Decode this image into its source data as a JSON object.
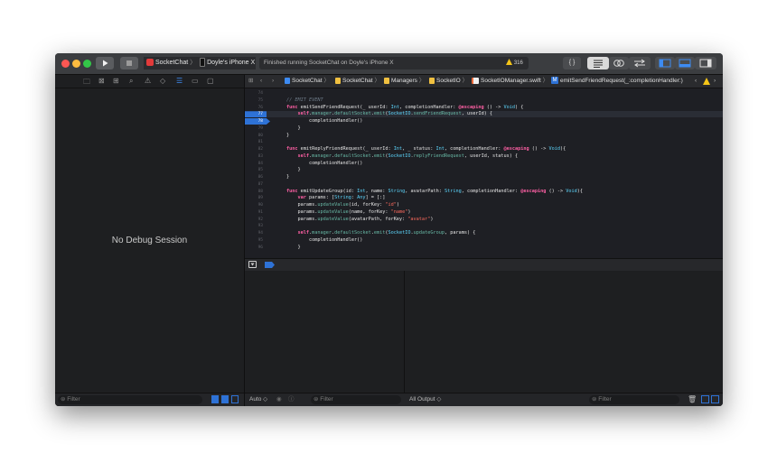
{
  "toolbar": {
    "scheme_name": "SocketChat",
    "scheme_sep": "〉",
    "device_name": "Doyle's iPhone X",
    "status_text": "Finished running SocketChat on Doyle's iPhone X",
    "warning_count": "316",
    "braces_label": "{ }"
  },
  "navigator": {
    "empty_text": "No Debug Session",
    "filter_placeholder": "Filter"
  },
  "jumpbar": {
    "crumbs": [
      "SocketChat",
      "SocketChat",
      "Managers",
      "SocketIO",
      "SocketIOManager.swift",
      "emitSendFriendRequest(_:completionHandler:)"
    ],
    "method_badge": "M"
  },
  "code": {
    "lines": [
      {
        "n": "74",
        "html": ""
      },
      {
        "n": "75",
        "html": "<span class='cm'>// EMIT EVENT</span>"
      },
      {
        "n": "76",
        "html": "<span class='kw'>func</span> emitSendFriendRequest(_ userId: <span class='ty'>Int</span>, completionHandler: <span class='kw'>@escaping</span> () -> <span class='ty'>Void</span>) {"
      },
      {
        "n": "77",
        "html": "    <span class='kw'>self</span>.<span class='fn'>manager</span>.<span class='fn'>defaultSocket</span>.<span class='fn'>emit</span>(<span class='ty'>SocketIO</span>.<span class='fn'>sendFriendRequest</span>, userId) {"
      },
      {
        "n": "78",
        "html": "        completionHandler()"
      },
      {
        "n": "79",
        "html": "    }"
      },
      {
        "n": "80",
        "html": "}"
      },
      {
        "n": "81",
        "html": ""
      },
      {
        "n": "82",
        "html": "<span class='kw'>func</span> emitReplyFriendRequest(_ userId: <span class='ty'>Int</span>, _ status: <span class='ty'>Int</span>, completionHandler: <span class='kw'>@escaping</span> () -> <span class='ty'>Void</span>){"
      },
      {
        "n": "83",
        "html": "    <span class='kw'>self</span>.<span class='fn'>manager</span>.<span class='fn'>defaultSocket</span>.<span class='fn'>emit</span>(<span class='ty'>SocketIO</span>.<span class='fn'>replyFriendRequest</span>, userId, status) {"
      },
      {
        "n": "84",
        "html": "        completionHandler()"
      },
      {
        "n": "85",
        "html": "    }"
      },
      {
        "n": "86",
        "html": "}"
      },
      {
        "n": "87",
        "html": ""
      },
      {
        "n": "88",
        "html": "<span class='kw'>func</span> emitUpdateGroup(id: <span class='ty'>Int</span>, name: <span class='ty'>String</span>, avatarPath: <span class='ty'>String</span>, completionHandler: <span class='kw'>@escaping</span> () -> <span class='ty'>Void</span>){"
      },
      {
        "n": "89",
        "html": "    <span class='kw'>var</span> params: [<span class='ty'>String</span>: <span class='ty'>Any</span>] = [:]"
      },
      {
        "n": "90",
        "html": "    params.<span class='fn'>updateValue</span>(id, forKey: <span class='str'>\"id\"</span>)"
      },
      {
        "n": "91",
        "html": "    params.<span class='fn'>updateValue</span>(name, forKey: <span class='str'>\"name\"</span>)"
      },
      {
        "n": "92",
        "html": "    params.<span class='fn'>updateValue</span>(avatarPath, forKey: <span class='str'>\"avatar\"</span>)"
      },
      {
        "n": "93",
        "html": ""
      },
      {
        "n": "94",
        "html": "    <span class='kw'>self</span>.<span class='fn'>manager</span>.<span class='fn'>defaultSocket</span>.<span class='fn'>emit</span>(<span class='ty'>SocketIO</span>.<span class='fn'>updateGroup</span>, params) {"
      },
      {
        "n": "95",
        "html": "        completionHandler()"
      },
      {
        "n": "96",
        "html": "    }"
      }
    ],
    "breakpoint_lines": [
      "77",
      "78"
    ],
    "highlighted_line": "77"
  },
  "debug": {
    "scope_label": "Auto ◇",
    "var_filter_placeholder": "Filter",
    "output_label": "All Output ◇",
    "console_filter_placeholder": "Filter"
  },
  "colors": {
    "accent": "#2e72d6",
    "warning": "#f5c518",
    "close": "#fc5753",
    "minimize": "#fdbc40",
    "zoom": "#33c748"
  }
}
